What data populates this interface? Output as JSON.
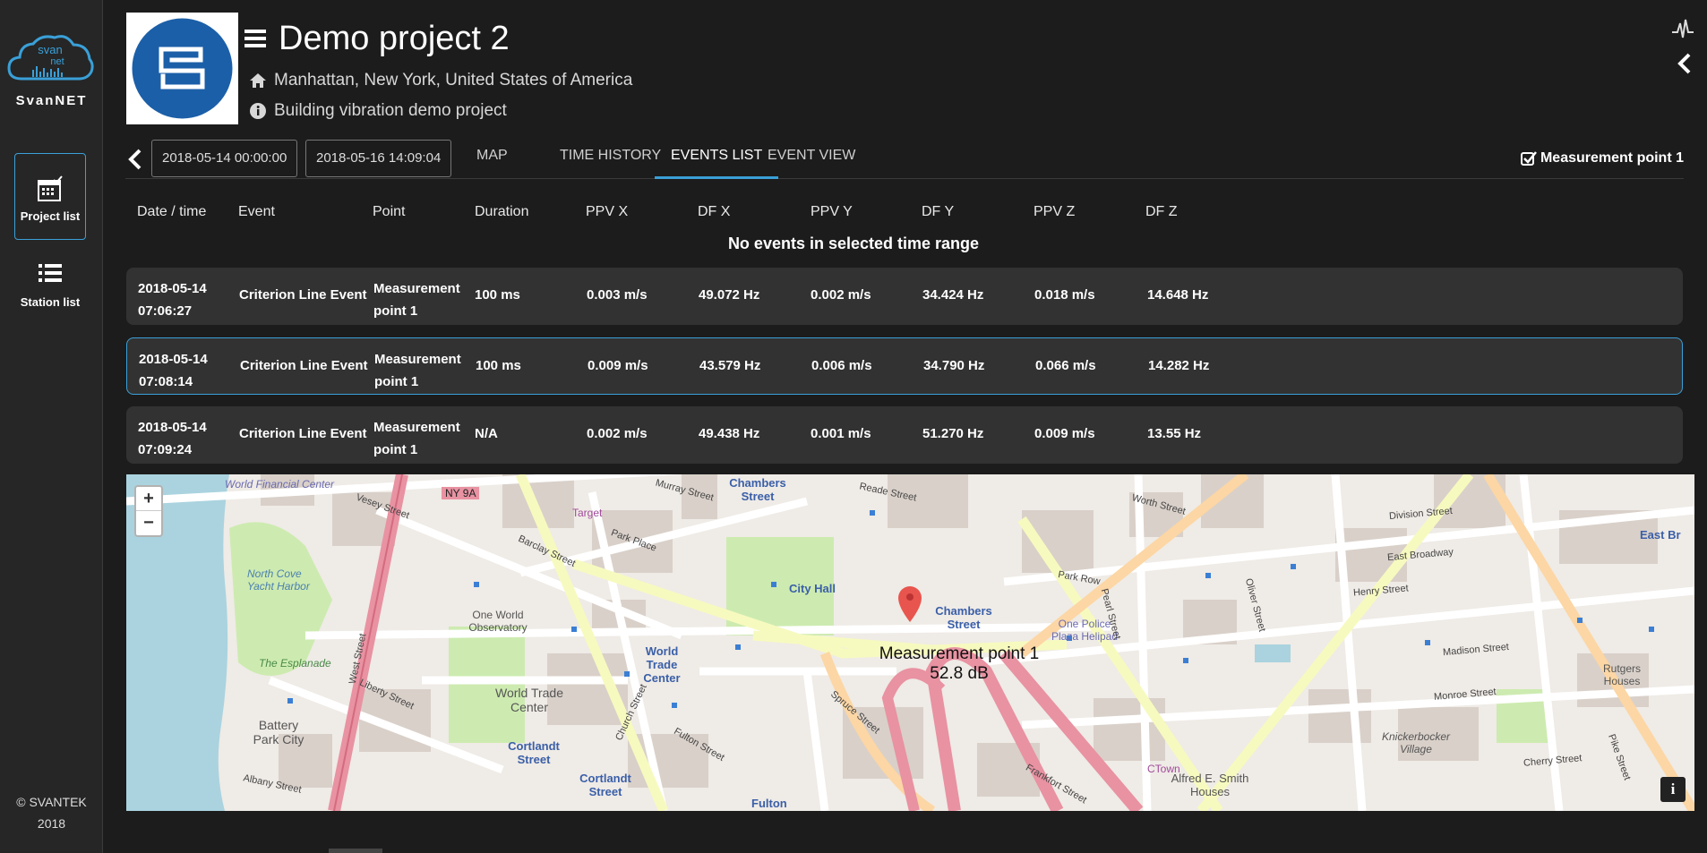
{
  "sidebar": {
    "logo_top": "svan",
    "logo_bottom": "net",
    "brand": "SvanNET",
    "nav": [
      {
        "label": "Project list",
        "icon": "calendar-check-icon",
        "active": true
      },
      {
        "label": "Station list",
        "icon": "list-icon",
        "active": false
      }
    ],
    "copyright_line1": "© SVANTEK",
    "copyright_line2": "2018"
  },
  "header": {
    "title": "Demo project 2",
    "location": "Manhattan, New York, United States of America",
    "description": "Building vibration demo project"
  },
  "toolbar": {
    "date_from": "2018-05-14 00:00:00",
    "date_to": "2018-05-16 14:09:04",
    "tabs": [
      "MAP",
      "TIME HISTORY",
      "EVENTS LIST",
      "EVENT VIEW"
    ],
    "active_tab": "EVENTS LIST",
    "measurement_point": "Measurement point 1"
  },
  "table": {
    "headers": [
      "Date / time",
      "Event",
      "Point",
      "Duration",
      "PPV X",
      "DF X",
      "PPV Y",
      "DF Y",
      "PPV Z",
      "DF Z"
    ],
    "empty_message": "No events in selected time range",
    "rows": [
      {
        "date": "2018-05-14",
        "time": "07:06:27",
        "event": "Criterion Line Event",
        "point_l1": "Measurement",
        "point_l2": "point 1",
        "duration": "100 ms",
        "ppvx": "0.003 m/s",
        "dfx": "49.072 Hz",
        "ppvy": "0.002 m/s",
        "dfy": "34.424 Hz",
        "ppvz": "0.018 m/s",
        "dfz": "14.648 Hz"
      },
      {
        "date": "2018-05-14",
        "time": "07:08:14",
        "event": "Criterion Line Event",
        "point_l1": "Measurement",
        "point_l2": "point 1",
        "duration": "100 ms",
        "ppvx": "0.009 m/s",
        "dfx": "43.579 Hz",
        "ppvy": "0.006 m/s",
        "dfy": "34.790 Hz",
        "ppvz": "0.066 m/s",
        "dfz": "14.282 Hz"
      },
      {
        "date": "2018-05-14",
        "time": "07:09:24",
        "event": "Criterion Line Event",
        "point_l1": "Measurement",
        "point_l2": "point 1",
        "duration": "N/A",
        "ppvx": "0.002 m/s",
        "dfx": "49.438 Hz",
        "ppvy": "0.001 m/s",
        "dfy": "51.270 Hz",
        "ppvz": "0.009 m/s",
        "dfz": "13.55 Hz"
      }
    ]
  },
  "map": {
    "zoom_in": "+",
    "zoom_out": "−",
    "info": "i",
    "marker_name": "Measurement point 1",
    "marker_value": "52.8 dB",
    "labels": {
      "world_financial": "World Financial Center",
      "vesey": "Vesey Street",
      "ny9a": "NY 9A",
      "target": "Target",
      "chambers1": "Chambers Street",
      "reade": "Reade Street",
      "worth": "Worth Street",
      "division": "Division Street",
      "eastbroadway": "East Broadway",
      "eastbr2": "East Br",
      "barclay": "Barclay Street",
      "park_place": "Park Place",
      "murray": "Murray Street",
      "north_cove": "North Cove Yacht Harbor",
      "one_world": "One World Observatory",
      "city_hall": "City Hall",
      "chambers2": "Chambers Street",
      "park_row": "Park Row",
      "police": "One Police Plaza Helipad",
      "henry": "Henry Street",
      "madison": "Madison Street",
      "esplanade": "The Esplanade",
      "wtc1": "World Trade Center",
      "wtc2": "World Trade Center",
      "liberty": "Liberty Street",
      "battery": "Battery Park City",
      "cortlandt1": "Cortlandt Street",
      "cortlandt2": "Cortlandt Street",
      "fulton": "Fulton Street",
      "fulton2": "Fulton",
      "spruce": "Spruce Street",
      "frankfort": "Frankfort Street",
      "monroe": "Monroe Street",
      "cherry": "Cherry Street",
      "knickerbocker": "Knickerbocker Village",
      "alfred": "Alfred E. Smith Houses",
      "rutgers": "Rutgers Houses",
      "ctown": "CTown",
      "albany": "Albany Street",
      "westst": "West Street",
      "church": "Church Street",
      "pike": "Pike Street",
      "pearl": "Pearl Street",
      "oliver": "Oliver Street"
    }
  }
}
